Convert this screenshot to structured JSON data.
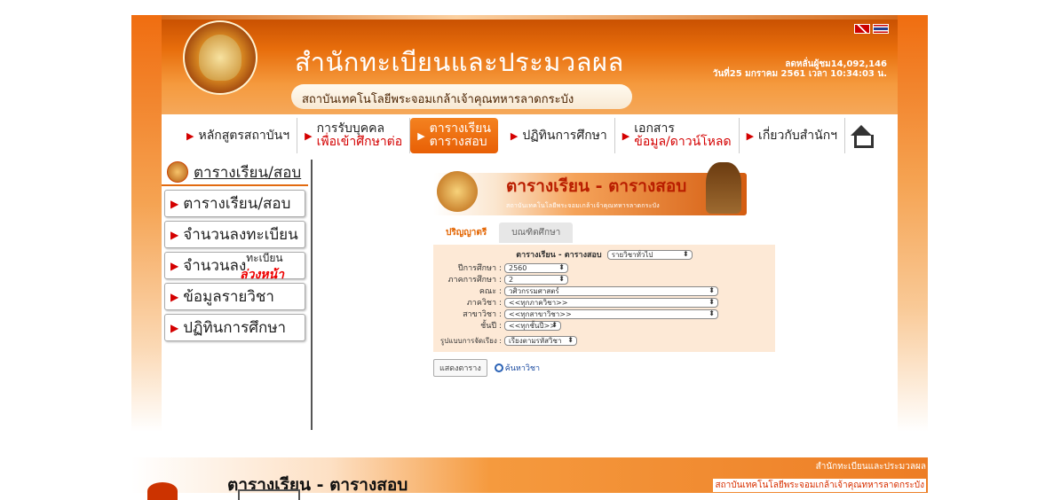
{
  "header": {
    "title": "สำนักทะเบียนและประมวลผล",
    "subtitle": "สถาบันเทคโนโลยีพระจอมเกล้าเจ้าคุณทหารลาดกระบัง",
    "counter_line1": "ลดหลั่นผู้ชม14,092,146",
    "counter_line2": "วันที่25 มกราคม 2561 เวลา 10:34:03 น."
  },
  "nav": {
    "items": [
      {
        "l1": "หลักสูตรสถาบันฯ",
        "l2": ""
      },
      {
        "l1": "การรับบุคคล",
        "l2": "เพื่อเข้าศึกษาต่อ"
      },
      {
        "l1": "ตารางเรียน",
        "l2": "ตารางสอบ"
      },
      {
        "l1": "ปฏิทินการศึกษา",
        "l2": ""
      },
      {
        "l1": "เอกสาร",
        "l2": "ข้อมูล/ดาวน์โหลด"
      },
      {
        "l1": "เกี่ยวกับสำนักฯ",
        "l2": ""
      }
    ]
  },
  "sidebar": {
    "heading": "ตารางเรียน/สอบ",
    "items": [
      "ตารางเรียน/สอบ",
      "จำนวนลงทะเบียน",
      "จำนวนลง",
      "ข้อมูลรายวิชา",
      "ปฏิทินการศึกษา"
    ],
    "item3_sup": "ทะเบียน",
    "item3_advance": "ล่วงหน้า"
  },
  "content": {
    "banner_title": "ตารางเรียน - ตารางสอบ",
    "banner_sub": "สถาบันเทคโนโลยีพระจอมเกล้าเจ้าคุณทหารลาดกระบัง",
    "tab_active": "ปริญญาตรี",
    "tab_inactive": "บณฑิตศึกษา",
    "form_title": "ตารางเรียน - ตารางสอบ",
    "form_title_select": "รายวิชาทั่วไป",
    "fields": [
      {
        "label": "ปีการศึกษา :",
        "value": "2560"
      },
      {
        "label": "ภาคการศึกษา :",
        "value": "2"
      },
      {
        "label": "คณะ :",
        "value": "วศิวกรรมศาสตร์"
      },
      {
        "label": "ภาควิชา :",
        "value": "<<ทุกภาควิชา>>"
      },
      {
        "label": "สาขาวิชา :",
        "value": "<<ทุกสาขาวิชา>>"
      },
      {
        "label": "ชั้นปี :",
        "value": "<<ทุกชั้นปี>>"
      },
      {
        "label": "รูปแบบการจัดเรียง :",
        "value": "เรียงตามรหัสวิชา"
      }
    ],
    "show_button": "แสดงตาราง",
    "search_link": "ค้นหาวิชา"
  },
  "footer": {
    "title": "ตารางเรียน - ตารางสอบ",
    "right1": "สำนักทะเบียนและประมวลผล",
    "right2": "สถาบันเทคโนโลยีพระจอมเกล้าเจ้าคุณทหารลาดกระบัง"
  }
}
